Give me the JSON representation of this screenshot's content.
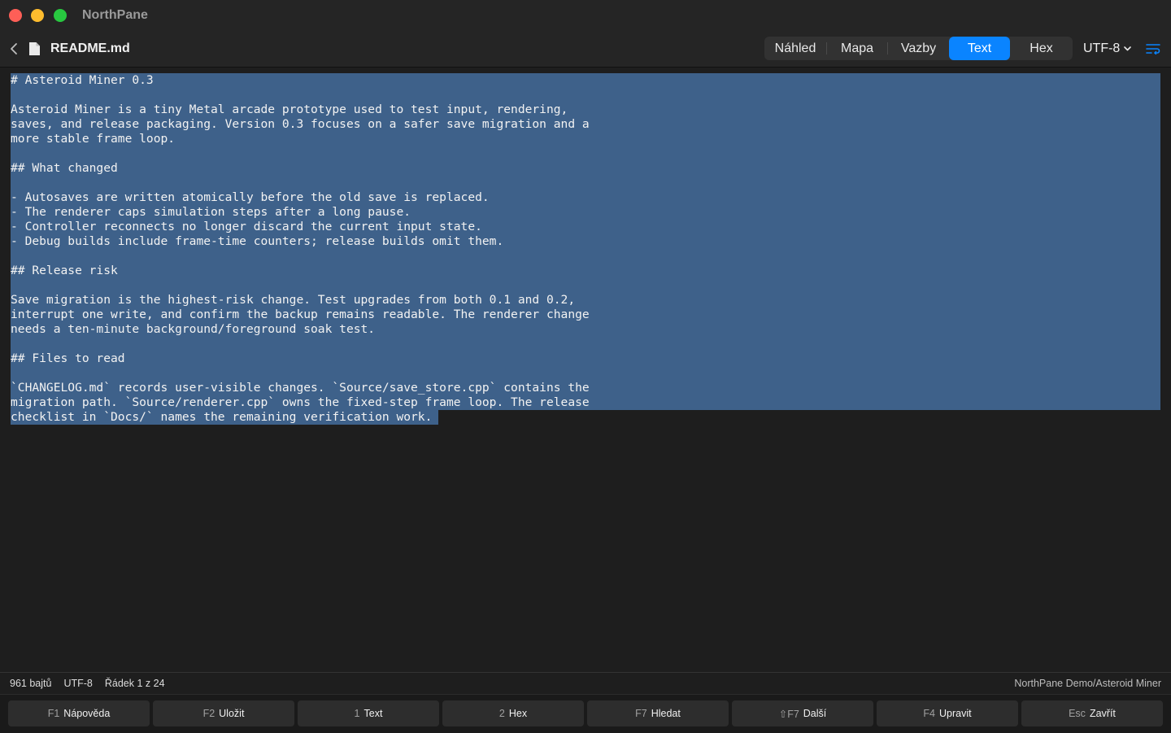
{
  "window": {
    "app_name": "NorthPane"
  },
  "toolbar": {
    "file_name": "README.md",
    "view_modes": [
      {
        "label": "Náhled",
        "active": false
      },
      {
        "label": "Mapa",
        "active": false
      },
      {
        "label": "Vazby",
        "active": false
      },
      {
        "label": "Text",
        "active": true
      },
      {
        "label": "Hex",
        "active": false
      }
    ],
    "encoding": "UTF-8",
    "accent_color": "#0a84ff"
  },
  "document": {
    "selection_color": "#3e618a",
    "lines": [
      "# Asteroid Miner 0.3",
      "",
      "Asteroid Miner is a tiny Metal arcade prototype used to test input, rendering,",
      "saves, and release packaging. Version 0.3 focuses on a safer save migration and a",
      "more stable frame loop.",
      "",
      "## What changed",
      "",
      "- Autosaves are written atomically before the old save is replaced.",
      "- The renderer caps simulation steps after a long pause.",
      "- Controller reconnects no longer discard the current input state.",
      "- Debug builds include frame-time counters; release builds omit them.",
      "",
      "## Release risk",
      "",
      "Save migration is the highest-risk change. Test upgrades from both 0.1 and 0.2,",
      "interrupt one write, and confirm the backup remains readable. The renderer change",
      "needs a ten-minute background/foreground soak test.",
      "",
      "## Files to read",
      "",
      "`CHANGELOG.md` records user-visible changes. `Source/save_store.cpp` contains the",
      "migration path. `Source/renderer.cpp` owns the fixed-step frame loop. The release",
      "checklist in `Docs/` names the remaining verification work."
    ]
  },
  "status": {
    "size": "961 bajtů",
    "encoding": "UTF-8",
    "line_info": "Řádek 1 z 24",
    "path": "NorthPane Demo/Asteroid Miner"
  },
  "function_keys": [
    {
      "key": "F1",
      "label": "Nápověda"
    },
    {
      "key": "F2",
      "label": "Uložit"
    },
    {
      "key": "1",
      "label": "Text"
    },
    {
      "key": "2",
      "label": "Hex"
    },
    {
      "key": "F7",
      "label": "Hledat"
    },
    {
      "key": "⇧F7",
      "label": "Další"
    },
    {
      "key": "F4",
      "label": "Upravit"
    },
    {
      "key": "Esc",
      "label": "Zavřít"
    }
  ]
}
